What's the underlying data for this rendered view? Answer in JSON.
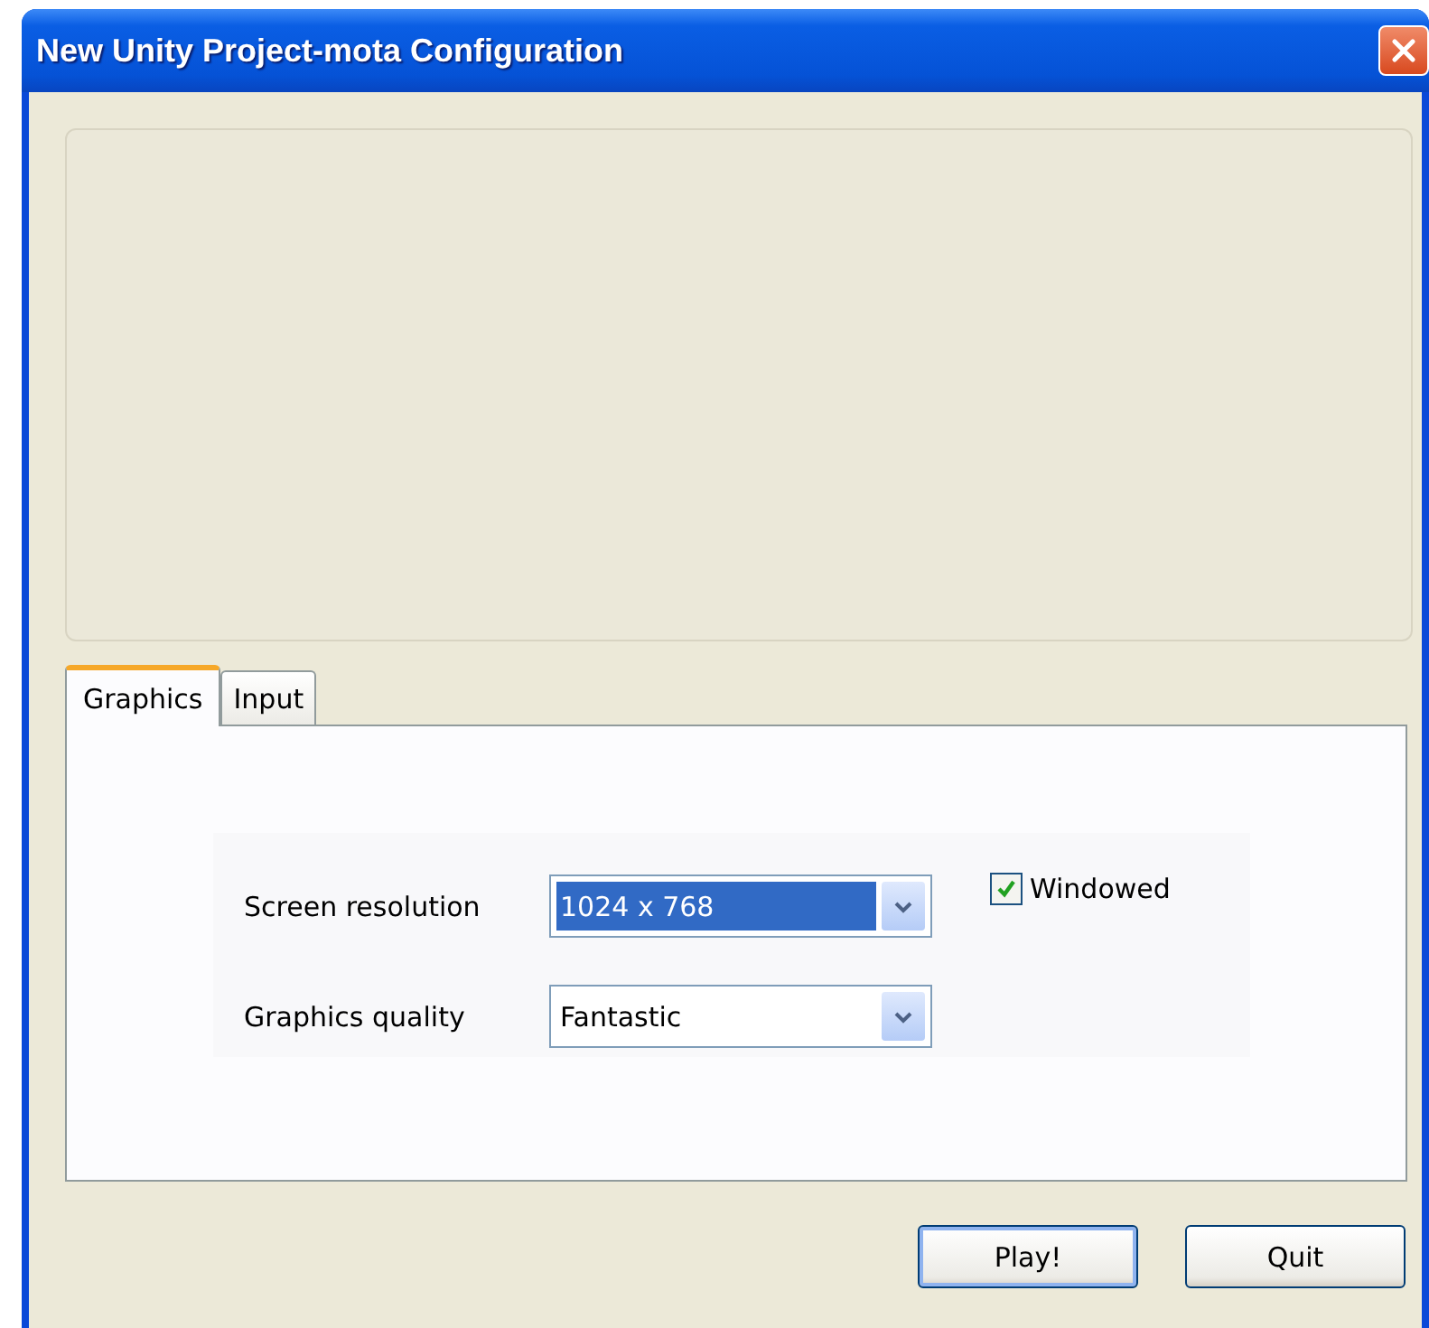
{
  "window": {
    "title": "New Unity Project-mota Configuration"
  },
  "tabs": [
    {
      "label": "Graphics",
      "selected": true
    },
    {
      "label": "Input",
      "selected": false
    }
  ],
  "settings": [
    {
      "kind": "dropdown",
      "label": "Screen resolution",
      "value": "1024 x 768",
      "highlighted": true
    },
    {
      "kind": "dropdown",
      "label": "Graphics quality",
      "value": "Fantastic",
      "highlighted": false
    }
  ],
  "windowed": {
    "label": "Windowed",
    "checked": true
  },
  "buttons": [
    {
      "label": "Play!",
      "default": true
    },
    {
      "label": "Quit",
      "default": false
    }
  ]
}
